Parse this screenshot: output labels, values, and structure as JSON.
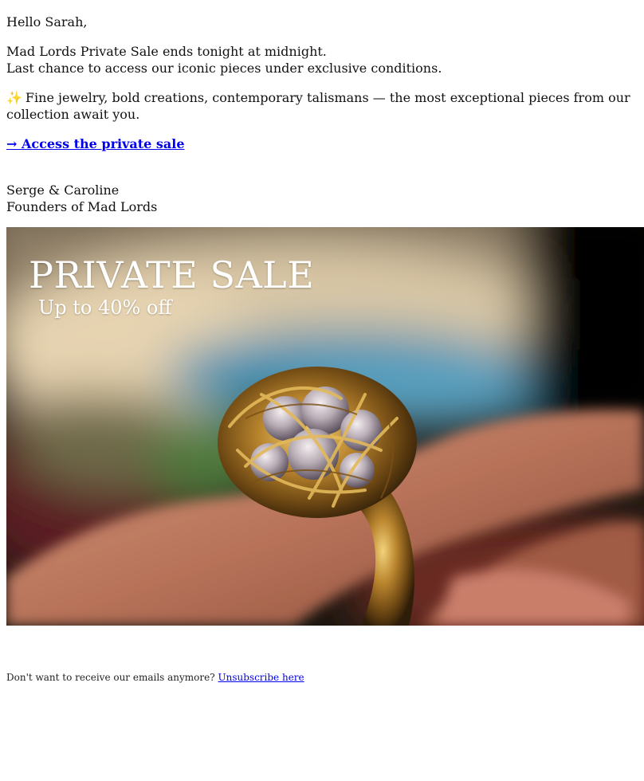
{
  "greeting": "Hello Sarah,",
  "intro": {
    "line1": "Mad Lords Private Sale ends tonight at midnight.",
    "line2": "Last chance to access our iconic pieces under exclusive conditions."
  },
  "teaser": {
    "icon": "sparkles-icon",
    "text": "Fine jewelry, bold creations, contemporary talismans — the most exceptional pieces from our collection await you."
  },
  "cta": {
    "label": "→ Access the private sale"
  },
  "signoff": {
    "names": "Serge & Caroline",
    "role": "Founders of Mad Lords"
  },
  "hero": {
    "title": "PRIVATE SALE",
    "subtitle": "Up to 40% off"
  },
  "footer": {
    "text": "Don't want to receive our emails anymore?",
    "link": "Unsubscribe here"
  },
  "colors": {
    "link": "#0000ee",
    "text": "#111111",
    "sparkle": "#f2b300"
  }
}
